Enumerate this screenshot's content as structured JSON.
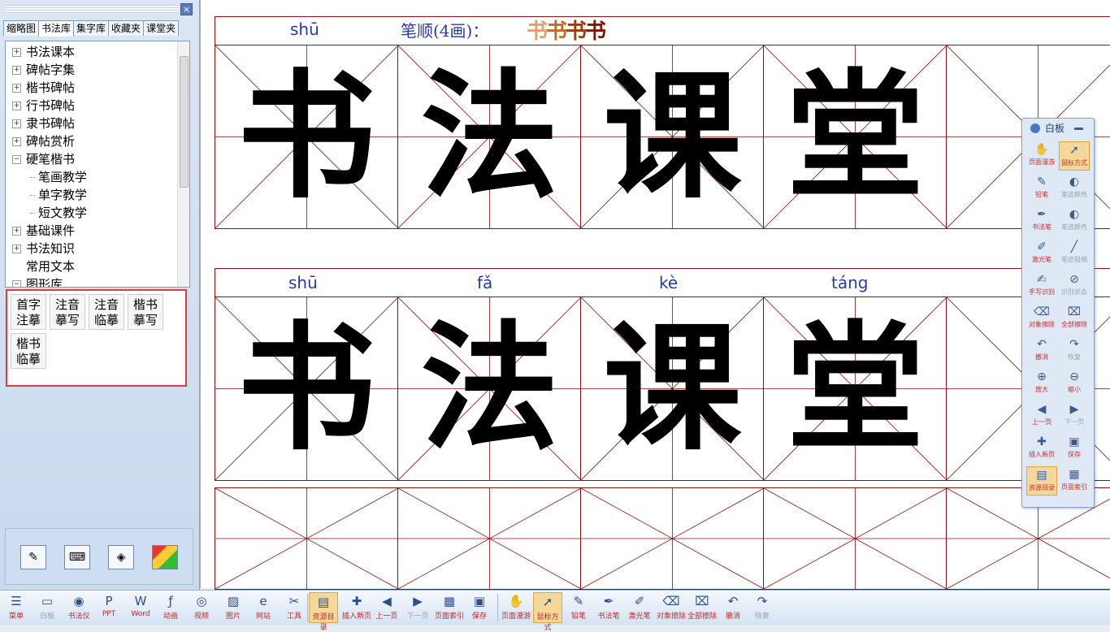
{
  "left_panel": {
    "close_glyph": "×",
    "tabs": [
      "缩略图",
      "书法库",
      "集字库",
      "收藏夹",
      "课堂夹"
    ],
    "active_tab": "书法库",
    "tree": [
      {
        "label": "书法课本",
        "expander": "+"
      },
      {
        "label": "碑帖字集",
        "expander": "+"
      },
      {
        "label": "楷书碑帖",
        "expander": "+"
      },
      {
        "label": "行书碑帖",
        "expander": "+"
      },
      {
        "label": "隶书碑帖",
        "expander": "+"
      },
      {
        "label": "碑帖赏析",
        "expander": "+"
      },
      {
        "label": "硬笔楷书",
        "expander": "−"
      },
      {
        "label": "笔画教学",
        "expander": ""
      },
      {
        "label": "单字教学",
        "expander": ""
      },
      {
        "label": "短文教学",
        "expander": ""
      },
      {
        "label": "基础课件",
        "expander": "+"
      },
      {
        "label": "书法知识",
        "expander": "+"
      },
      {
        "label": "常用文本",
        "expander": ""
      },
      {
        "label": "图形库",
        "expander": "−"
      }
    ],
    "mode_buttons": [
      "首字注摹",
      "注音摹写",
      "注音临摹",
      "楷书摹写",
      "楷书临摹"
    ],
    "bottom_icons": [
      "pencil-icon",
      "keyboard-icon",
      "paint-bucket-icon",
      "palette-icon"
    ]
  },
  "main": {
    "top_row": {
      "pinyin": "shū",
      "stroke_order_label": "笔顺(4画)：",
      "stroke_chars": [
        "书",
        "书",
        "书",
        "书"
      ],
      "stroke_colors": [
        "#e0a070",
        "#c26a2c",
        "#a23a0c",
        "#7a1a02"
      ],
      "chars": [
        "书",
        "法",
        "课",
        "堂",
        ""
      ]
    },
    "middle_row": {
      "pinyin": [
        "shū",
        "fǎ",
        "kè",
        "táng",
        ""
      ],
      "chars": [
        "书",
        "法",
        "课",
        "堂",
        ""
      ]
    },
    "bottom_row": {
      "chars": [
        "",
        "",
        "",
        "",
        ""
      ]
    },
    "grid_color": "#8a1212",
    "pinyin_color": "#2a3aa8"
  },
  "whiteboard": {
    "title": "白板",
    "buttons": [
      {
        "label": "页面漫游",
        "icon": "hand-icon",
        "state": "normal"
      },
      {
        "label": "鼠标方式",
        "icon": "cursor-icon",
        "state": "on"
      },
      {
        "label": "铅笔",
        "icon": "pencil-icon",
        "state": "normal"
      },
      {
        "label": "笔迹颜色",
        "icon": "color-icon",
        "state": "dis"
      },
      {
        "label": "书法笔",
        "icon": "brush-icon",
        "state": "normal"
      },
      {
        "label": "笔迹颜色",
        "icon": "color-icon",
        "state": "dis"
      },
      {
        "label": "激光笔",
        "icon": "laser-icon",
        "state": "normal"
      },
      {
        "label": "笔迹粗细",
        "icon": "width-icon",
        "state": "dis"
      },
      {
        "label": "手写识别",
        "icon": "recognize-icon",
        "state": "normal"
      },
      {
        "label": "识别状态",
        "icon": "status-icon",
        "state": "dis"
      },
      {
        "label": "对象擦除",
        "icon": "eraser-icon",
        "state": "normal"
      },
      {
        "label": "全部擦除",
        "icon": "clear-icon",
        "state": "normal"
      },
      {
        "label": "撤消",
        "icon": "undo-icon",
        "state": "normal"
      },
      {
        "label": "恢复",
        "icon": "redo-icon",
        "state": "dis"
      },
      {
        "label": "放大",
        "icon": "zoom-in-icon",
        "state": "normal"
      },
      {
        "label": "缩小",
        "icon": "zoom-out-icon",
        "state": "normal"
      },
      {
        "label": "上一页",
        "icon": "prev-icon",
        "state": "normal"
      },
      {
        "label": "下一页",
        "icon": "next-icon",
        "state": "dis"
      },
      {
        "label": "插入新页",
        "icon": "insert-page-icon",
        "state": "normal"
      },
      {
        "label": "保存",
        "icon": "save-icon",
        "state": "normal"
      },
      {
        "label": "资源目录",
        "icon": "folder-icon",
        "state": "on"
      },
      {
        "label": "页面索引",
        "icon": "index-icon",
        "state": "normal"
      }
    ]
  },
  "toolbar": [
    {
      "label": "菜单",
      "icon": "menu-icon",
      "state": "normal"
    },
    {
      "label": "白板",
      "icon": "whiteboard-icon",
      "state": "dis"
    },
    {
      "label": "书法仪",
      "icon": "camera-icon",
      "state": "normal"
    },
    {
      "label": "PPT",
      "icon": "ppt-icon",
      "state": "normal"
    },
    {
      "label": "Word",
      "icon": "word-icon",
      "state": "normal"
    },
    {
      "label": "动画",
      "icon": "flash-icon",
      "state": "normal"
    },
    {
      "label": "视频",
      "icon": "video-icon",
      "state": "normal"
    },
    {
      "label": "图片",
      "icon": "picture-icon",
      "state": "normal"
    },
    {
      "label": "网站",
      "icon": "web-icon",
      "state": "normal"
    },
    {
      "label": "工具",
      "icon": "tools-icon",
      "state": "normal"
    },
    {
      "label": "资源目录",
      "icon": "folder-icon",
      "state": "on"
    },
    {
      "label": "插入新页",
      "icon": "insert-page-icon",
      "state": "normal"
    },
    {
      "label": "上一页",
      "icon": "prev-icon",
      "state": "normal"
    },
    {
      "label": "下一页",
      "icon": "next-icon",
      "state": "dis"
    },
    {
      "label": "页面索引",
      "icon": "index-icon",
      "state": "normal"
    },
    {
      "label": "保存",
      "icon": "save-icon",
      "state": "normal"
    },
    {
      "label": "页面漫游",
      "icon": "hand-icon",
      "state": "normal"
    },
    {
      "label": "鼠标方式",
      "icon": "cursor-icon",
      "state": "on"
    },
    {
      "label": "铅笔",
      "icon": "pencil-icon",
      "state": "normal"
    },
    {
      "label": "书法笔",
      "icon": "brush-icon",
      "state": "normal"
    },
    {
      "label": "激光笔",
      "icon": "laser-icon",
      "state": "normal"
    },
    {
      "label": "对象擦除",
      "icon": "eraser-icon",
      "state": "normal"
    },
    {
      "label": "全部擦除",
      "icon": "clear-icon",
      "state": "normal"
    },
    {
      "label": "撤消",
      "icon": "undo-icon",
      "state": "normal"
    },
    {
      "label": "恢复",
      "icon": "redo-icon",
      "state": "dis"
    }
  ]
}
